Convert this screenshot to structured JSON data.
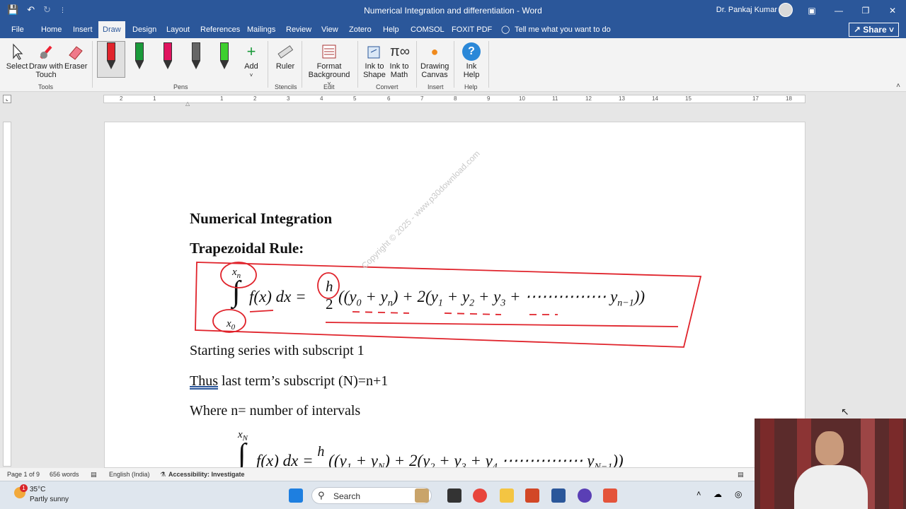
{
  "window": {
    "title": "Numerical Integration and differentiation  -  Word",
    "user": "Dr. Pankaj Kumar"
  },
  "menu": {
    "tabs": [
      "File",
      "Home",
      "Insert",
      "Draw",
      "Design",
      "Layout",
      "References",
      "Mailings",
      "Review",
      "View",
      "Zotero",
      "Help",
      "COMSOL",
      "FOXIT PDF"
    ],
    "active": "Draw",
    "tell_me": "Tell me what you want to do",
    "share": "Share"
  },
  "ribbon": {
    "tools": {
      "select": "Select",
      "draw_touch_1": "Draw with",
      "draw_touch_2": "Touch",
      "eraser": "Eraser",
      "group": "Tools"
    },
    "pens": {
      "add": "Add",
      "group": "Pens",
      "colors": [
        "#e0232b",
        "#1a9a3a",
        "#e0135f",
        "#666666",
        "#3ecf2f"
      ]
    },
    "stencils": {
      "ruler": "Ruler",
      "group": "Stencils"
    },
    "edit": {
      "format_1": "Format",
      "format_2": "Background",
      "group": "Edit"
    },
    "convert": {
      "ink_shape_1": "Ink to",
      "ink_shape_2": "Shape",
      "ink_math_1": "Ink to",
      "ink_math_2": "Math",
      "group": "Convert"
    },
    "insert": {
      "canvas_1": "Drawing",
      "canvas_2": "Canvas",
      "group": "Insert"
    },
    "help": {
      "ink_help_1": "Ink",
      "ink_help_2": "Help",
      "group": "Help"
    }
  },
  "ruler": {
    "numbers": [
      "2",
      "1",
      "1",
      "1",
      "2",
      "3",
      "4",
      "5",
      "6",
      "7",
      "8",
      "9",
      "10",
      "11",
      "12",
      "13",
      "14",
      "15",
      "17",
      "18"
    ]
  },
  "document": {
    "heading1": "Numerical Integration",
    "heading2": "Trapezoidal Rule:",
    "line1": "Starting series with subscript 1",
    "line2_thus": "Thus",
    "line2_rest": " last term’s subscript (N)=n+1",
    "line3": "Where n= number of intervals",
    "watermark": "Copyright © 2025 - www.p30download.com"
  },
  "status": {
    "page": "Page 1 of 9",
    "words": "656 words",
    "language": "English (India)",
    "accessibility": "Accessibility: Investigate"
  },
  "taskbar": {
    "temp": "35°C",
    "weather": "Partly sunny",
    "badge": "1",
    "search": "Search"
  }
}
